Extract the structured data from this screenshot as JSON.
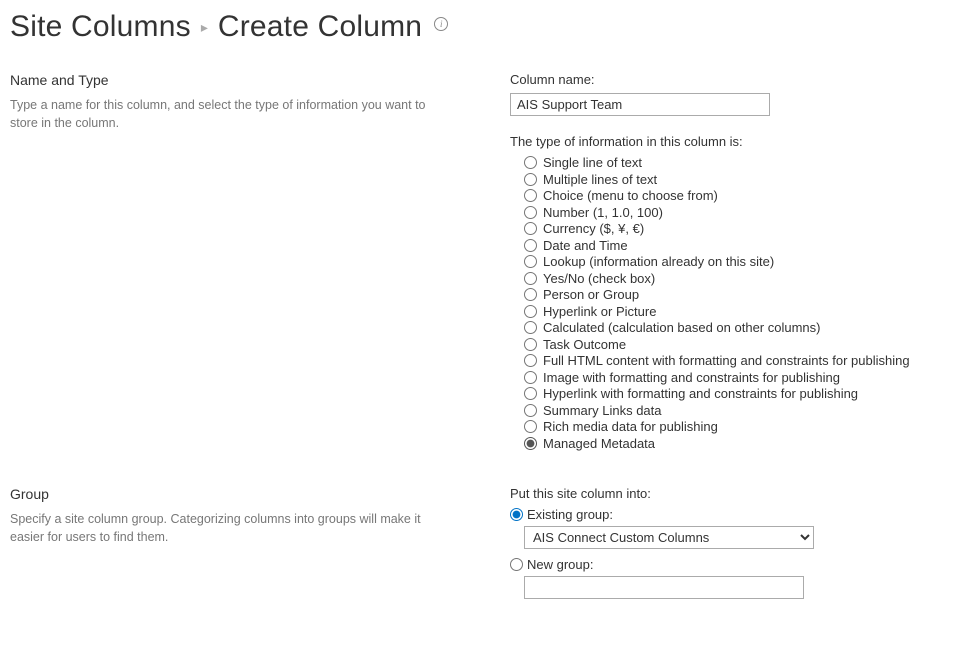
{
  "breadcrumb": {
    "parent": "Site Columns",
    "current": "Create Column"
  },
  "sections": {
    "name_type": {
      "heading": "Name and Type",
      "description": "Type a name for this column, and select the type of information you want to store in the column."
    },
    "group": {
      "heading": "Group",
      "description": "Specify a site column group. Categorizing columns into groups will make it easier for users to find them."
    }
  },
  "column_name": {
    "label": "Column name:",
    "value": "AIS Support Team"
  },
  "type_info": {
    "label": "The type of information in this column is:",
    "selected_index": 17,
    "options": [
      "Single line of text",
      "Multiple lines of text",
      "Choice (menu to choose from)",
      "Number (1, 1.0, 100)",
      "Currency ($, ¥, €)",
      "Date and Time",
      "Lookup (information already on this site)",
      "Yes/No (check box)",
      "Person or Group",
      "Hyperlink or Picture",
      "Calculated (calculation based on other columns)",
      "Task Outcome",
      "Full HTML content with formatting and constraints for publishing",
      "Image with formatting and constraints for publishing",
      "Hyperlink with formatting and constraints for publishing",
      "Summary Links data",
      "Rich media data for publishing",
      "Managed Metadata"
    ]
  },
  "group_field": {
    "label": "Put this site column into:",
    "existing_label": "Existing group:",
    "existing_value": "AIS Connect Custom Columns",
    "new_label": "New group:",
    "new_value": "",
    "selected": "existing"
  }
}
